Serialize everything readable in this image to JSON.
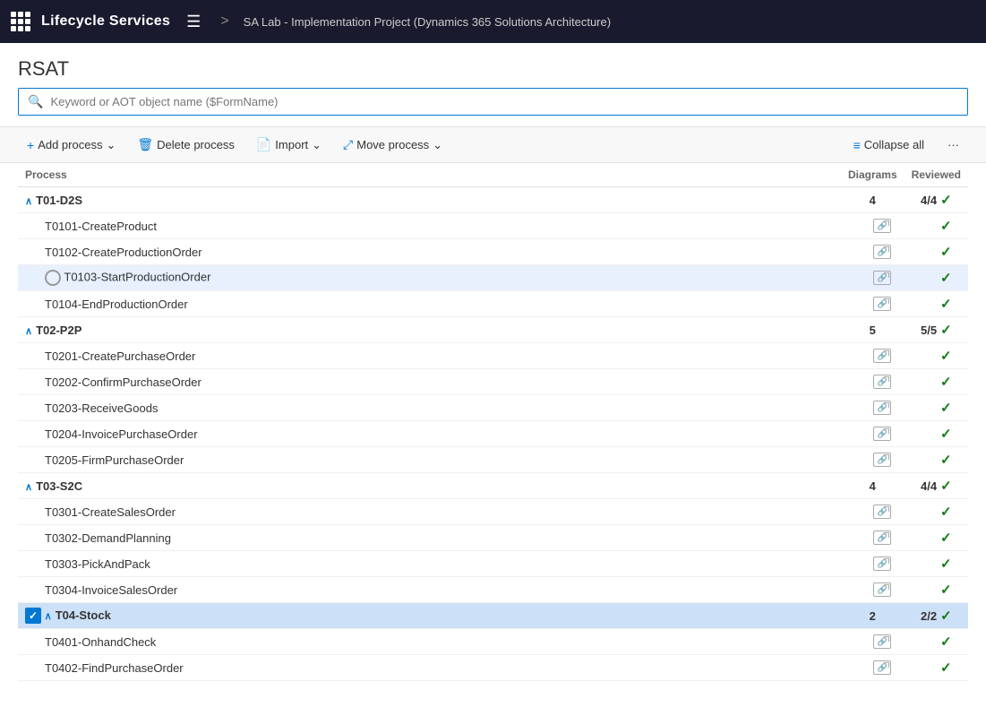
{
  "topbar": {
    "title": "Lifecycle Services",
    "breadcrumb": "SA Lab - Implementation Project (Dynamics 365 Solutions Architecture)"
  },
  "page": {
    "title": "RSAT"
  },
  "search": {
    "placeholder": "Keyword or AOT object name ($FormName)"
  },
  "toolbar": {
    "add_process": "Add process",
    "delete_process": "Delete process",
    "import": "Import",
    "move_process": "Move process",
    "collapse_all": "Collapse all"
  },
  "table": {
    "columns": {
      "process": "Process",
      "diagrams": "Diagrams",
      "reviewed": "Reviewed"
    },
    "groups": [
      {
        "id": "g1",
        "name": "T01-D2S",
        "diagrams": "4",
        "reviewed": "4/4",
        "check": true,
        "children": [
          {
            "name": "T0101-CreateProduct",
            "selected": false,
            "radio": false,
            "check": true
          },
          {
            "name": "T0102-CreateProductionOrder",
            "selected": false,
            "radio": false,
            "check": true
          },
          {
            "name": "T0103-StartProductionOrder",
            "selected": true,
            "radio": true,
            "check": true
          },
          {
            "name": "T0104-EndProductionOrder",
            "selected": false,
            "radio": false,
            "check": true
          }
        ]
      },
      {
        "id": "g2",
        "name": "T02-P2P",
        "diagrams": "5",
        "reviewed": "5/5",
        "check": true,
        "children": [
          {
            "name": "T0201-CreatePurchaseOrder",
            "selected": false,
            "radio": false,
            "check": true
          },
          {
            "name": "T0202-ConfirmPurchaseOrder",
            "selected": false,
            "radio": false,
            "check": true
          },
          {
            "name": "T0203-ReceiveGoods",
            "selected": false,
            "radio": false,
            "check": true
          },
          {
            "name": "T0204-InvoicePurchaseOrder",
            "selected": false,
            "radio": false,
            "check": true
          },
          {
            "name": "T0205-FirmPurchaseOrder",
            "selected": false,
            "radio": false,
            "check": true
          }
        ]
      },
      {
        "id": "g3",
        "name": "T03-S2C",
        "diagrams": "4",
        "reviewed": "4/4",
        "check": true,
        "children": [
          {
            "name": "T0301-CreateSalesOrder",
            "selected": false,
            "radio": false,
            "check": true
          },
          {
            "name": "T0302-DemandPlanning",
            "selected": false,
            "radio": false,
            "check": true
          },
          {
            "name": "T0303-PickAndPack",
            "selected": false,
            "radio": false,
            "check": true
          },
          {
            "name": "T0304-InvoiceSalesOrder",
            "selected": false,
            "radio": false,
            "check": true
          }
        ]
      },
      {
        "id": "g4",
        "name": "T04-Stock",
        "diagrams": "2",
        "reviewed": "2/2",
        "check": true,
        "selectedGroup": true,
        "blueCheck": true,
        "children": [
          {
            "name": "T0401-OnhandCheck",
            "selected": false,
            "radio": false,
            "check": true
          },
          {
            "name": "T0402-FindPurchaseOrder",
            "selected": false,
            "radio": false,
            "check": true
          }
        ]
      }
    ]
  }
}
